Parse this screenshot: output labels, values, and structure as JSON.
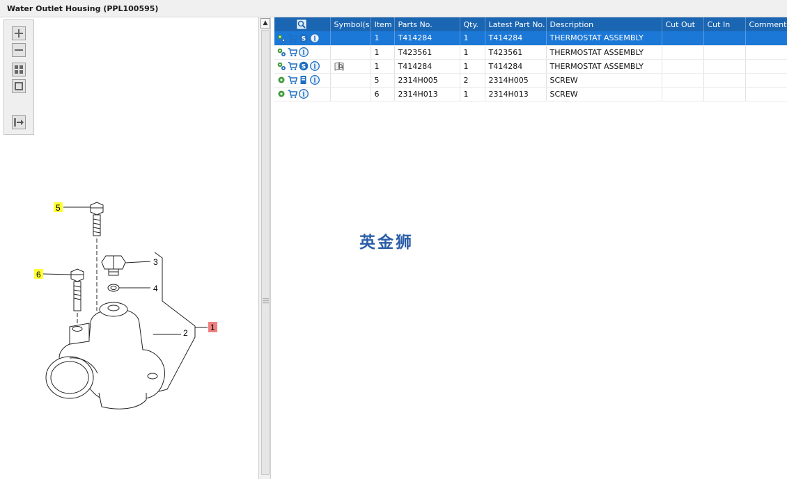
{
  "window": {
    "title": "Water Outlet Housing (PPL100595)"
  },
  "toolbar": {
    "buttons": [
      {
        "name": "zoom-in-button",
        "icon": "plus-icon"
      },
      {
        "name": "zoom-out-button",
        "icon": "minus-icon"
      },
      {
        "name": "fit-all-button",
        "icon": "grid-icon"
      },
      {
        "name": "fit-window-button",
        "icon": "square-icon"
      },
      {
        "name": "export-button",
        "icon": "export-icon"
      }
    ]
  },
  "diagram": {
    "callouts": [
      "5",
      "6",
      "3",
      "4",
      "2",
      "1"
    ],
    "highlight_colors": {
      "yellow": "#ffff33",
      "red": "#f08080"
    }
  },
  "grid": {
    "columns": [
      "",
      "Symbol(s)",
      "Item",
      "Parts No.",
      "Qty.",
      "Latest Part No.",
      "Description",
      "Cut Out",
      "Cut In",
      "Comment"
    ],
    "rows": [
      {
        "item": "1",
        "parts_no": "T414284",
        "qty": "1",
        "latest": "T414284",
        "desc": "THERMOSTAT ASSEMBLY",
        "cut_out": "",
        "cut_in": "",
        "comment": "",
        "selected": true,
        "icons": [
          "gears-icon",
          "cart-icon",
          "s-icon",
          "info-icon"
        ],
        "symbol": ""
      },
      {
        "item": "1",
        "parts_no": "T423561",
        "qty": "1",
        "latest": "T423561",
        "desc": "THERMOSTAT ASSEMBLY",
        "cut_out": "",
        "cut_in": "",
        "comment": "",
        "selected": false,
        "icons": [
          "gears-icon",
          "cart-icon",
          "info-icon"
        ],
        "symbol": ""
      },
      {
        "item": "1",
        "parts_no": "T414284",
        "qty": "1",
        "latest": "T414284",
        "desc": "THERMOSTAT ASSEMBLY",
        "cut_out": "",
        "cut_in": "",
        "comment": "",
        "selected": false,
        "icons": [
          "gears-icon",
          "cart-icon",
          "s-icon",
          "info-icon"
        ],
        "symbol": "book-icon"
      },
      {
        "item": "5",
        "parts_no": "2314H005",
        "qty": "2",
        "latest": "2314H005",
        "desc": "SCREW",
        "cut_out": "",
        "cut_in": "",
        "comment": "",
        "selected": false,
        "icons": [
          "gear-icon",
          "cart-icon",
          "document-icon",
          "info-icon"
        ],
        "symbol": ""
      },
      {
        "item": "6",
        "parts_no": "2314H013",
        "qty": "1",
        "latest": "2314H013",
        "desc": "SCREW",
        "cut_out": "",
        "cut_in": "",
        "comment": "",
        "selected": false,
        "icons": [
          "gear-icon",
          "cart-icon",
          "info-icon"
        ],
        "symbol": ""
      }
    ]
  },
  "watermark": {
    "text": "英金狮"
  },
  "colors": {
    "header_blue": "#1b66b3",
    "selected_row": "#1b78d7",
    "watermark": "#2a5ea8"
  }
}
